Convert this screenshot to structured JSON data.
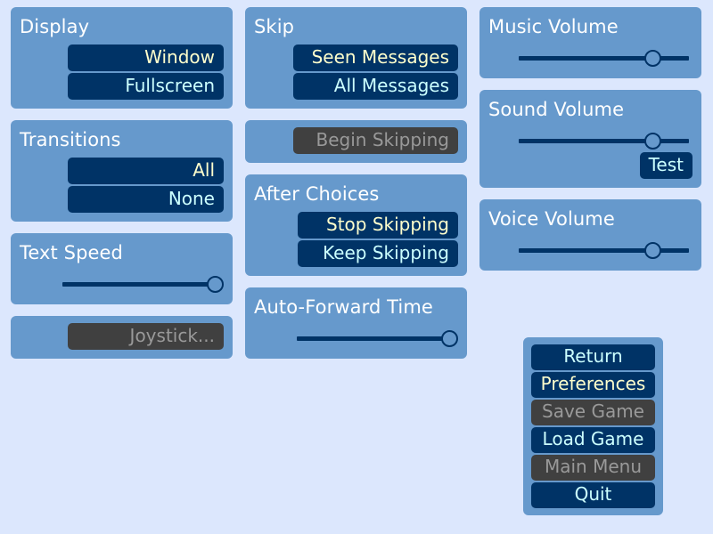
{
  "theme": {
    "background": "#dce7fd",
    "panel": "#6699cc",
    "button": "#003366",
    "button_disabled": "#404040",
    "text_idle": "#ccffff",
    "text_selected": "#ffffcc",
    "text_disabled": "#999999",
    "title": "#ffffff"
  },
  "columns": {
    "left": {
      "display": {
        "title": "Display",
        "options": [
          {
            "label": "Window",
            "state": "selected"
          },
          {
            "label": "Fullscreen",
            "state": "idle"
          }
        ]
      },
      "transitions": {
        "title": "Transitions",
        "options": [
          {
            "label": "All",
            "state": "selected"
          },
          {
            "label": "None",
            "state": "idle"
          }
        ]
      },
      "text_speed": {
        "title": "Text Speed",
        "slider": {
          "value": 100,
          "min": 0,
          "max": 100
        }
      },
      "joystick": {
        "label": "Joystick...",
        "state": "disabled"
      }
    },
    "middle": {
      "skip": {
        "title": "Skip",
        "options": [
          {
            "label": "Seen Messages",
            "state": "selected"
          },
          {
            "label": "All Messages",
            "state": "idle"
          }
        ]
      },
      "begin_skipping": {
        "label": "Begin Skipping",
        "state": "disabled"
      },
      "after_choices": {
        "title": "After Choices",
        "options": [
          {
            "label": "Stop Skipping",
            "state": "selected"
          },
          {
            "label": "Keep Skipping",
            "state": "idle"
          }
        ]
      },
      "auto_forward": {
        "title": "Auto-Forward Time",
        "slider": {
          "value": 100,
          "min": 0,
          "max": 100
        }
      }
    },
    "right": {
      "music_volume": {
        "title": "Music Volume",
        "slider": {
          "value": 79,
          "min": 0,
          "max": 100
        }
      },
      "sound_volume": {
        "title": "Sound Volume",
        "slider": {
          "value": 79,
          "min": 0,
          "max": 100
        },
        "test_button": {
          "label": "Test",
          "state": "idle"
        }
      },
      "voice_volume": {
        "title": "Voice Volume",
        "slider": {
          "value": 79,
          "min": 0,
          "max": 100
        }
      }
    }
  },
  "nav_menu": {
    "items": [
      {
        "label": "Return",
        "state": "idle"
      },
      {
        "label": "Preferences",
        "state": "selected"
      },
      {
        "label": "Save Game",
        "state": "disabled"
      },
      {
        "label": "Load Game",
        "state": "idle"
      },
      {
        "label": "Main Menu",
        "state": "disabled"
      },
      {
        "label": "Quit",
        "state": "idle"
      }
    ]
  }
}
